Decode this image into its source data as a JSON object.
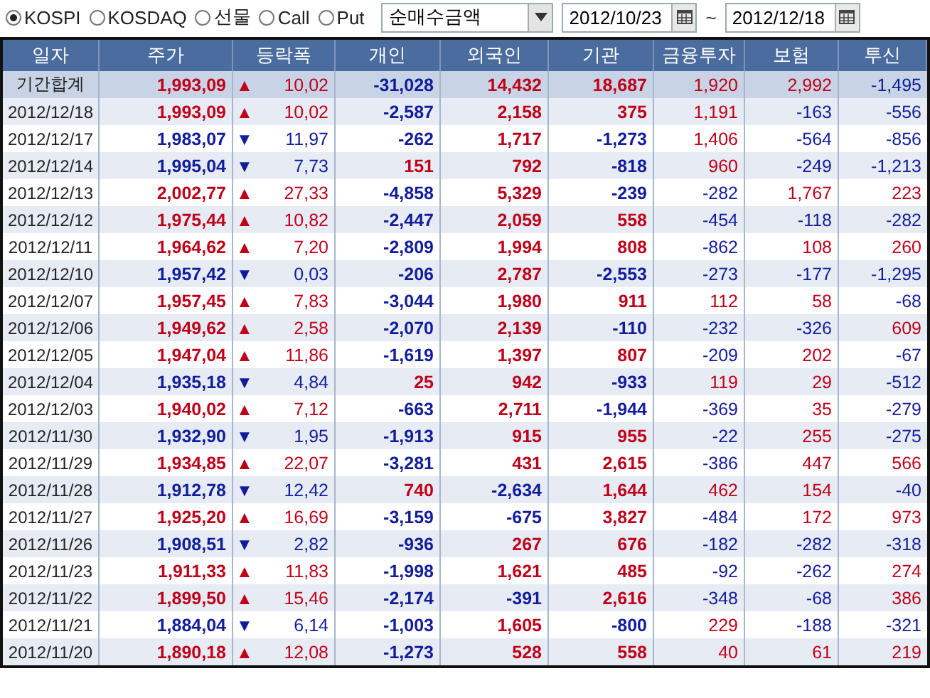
{
  "toolbar": {
    "markets": [
      {
        "label": "KOSPI",
        "selected": true
      },
      {
        "label": "KOSDAQ",
        "selected": false
      },
      {
        "label": "선물",
        "selected": false
      },
      {
        "label": "Call",
        "selected": false
      },
      {
        "label": "Put",
        "selected": false
      }
    ],
    "metric": "순매수금액",
    "date_from": "2012/10/23",
    "range_separator": "~",
    "date_to": "2012/12/18"
  },
  "table": {
    "columns": [
      "일자",
      "주가",
      "등락폭",
      "개인",
      "외국인",
      "기관",
      "금융투자",
      "보험",
      "투신"
    ],
    "rows": [
      {
        "kind": "summary",
        "date": "기간합계",
        "price": "1,993,09",
        "arrow": "▲",
        "color": "#c00018",
        "change": "10,02",
        "values": [
          "-31,028",
          "14,432",
          "18,687",
          "1,920",
          "2,992",
          "-1,495"
        ]
      },
      {
        "kind": "day",
        "date": "2012/12/18",
        "price": "1,993,09",
        "arrow": "▲",
        "color": "#c00018",
        "change": "10,02",
        "values": [
          "-2,587",
          "2,158",
          "375",
          "1,191",
          "-163",
          "-556"
        ]
      },
      {
        "kind": "day",
        "date": "2012/12/17",
        "price": "1,983,07",
        "arrow": "▼",
        "color": "#101c9c",
        "change": "11,97",
        "values": [
          "-262",
          "1,717",
          "-1,273",
          "1,406",
          "-564",
          "-856"
        ]
      },
      {
        "kind": "day",
        "date": "2012/12/14",
        "price": "1,995,04",
        "arrow": "▼",
        "color": "#101c9c",
        "change": "7,73",
        "values": [
          "151",
          "792",
          "-818",
          "960",
          "-249",
          "-1,213"
        ]
      },
      {
        "kind": "day",
        "date": "2012/12/13",
        "price": "2,002,77",
        "arrow": "▲",
        "color": "#c00018",
        "change": "27,33",
        "values": [
          "-4,858",
          "5,329",
          "-239",
          "-282",
          "1,767",
          "223"
        ]
      },
      {
        "kind": "day",
        "date": "2012/12/12",
        "price": "1,975,44",
        "arrow": "▲",
        "color": "#c00018",
        "change": "10,82",
        "values": [
          "-2,447",
          "2,059",
          "558",
          "-454",
          "-118",
          "-282"
        ]
      },
      {
        "kind": "day",
        "date": "2012/12/11",
        "price": "1,964,62",
        "arrow": "▲",
        "color": "#c00018",
        "change": "7,20",
        "values": [
          "-2,809",
          "1,994",
          "808",
          "-862",
          "108",
          "260"
        ]
      },
      {
        "kind": "day",
        "date": "2012/12/10",
        "price": "1,957,42",
        "arrow": "▼",
        "color": "#101c9c",
        "change": "0,03",
        "values": [
          "-206",
          "2,787",
          "-2,553",
          "-273",
          "-177",
          "-1,295"
        ]
      },
      {
        "kind": "day",
        "date": "2012/12/07",
        "price": "1,957,45",
        "arrow": "▲",
        "color": "#c00018",
        "change": "7,83",
        "values": [
          "-3,044",
          "1,980",
          "911",
          "112",
          "58",
          "-68"
        ]
      },
      {
        "kind": "day",
        "date": "2012/12/06",
        "price": "1,949,62",
        "arrow": "▲",
        "color": "#c00018",
        "change": "2,58",
        "values": [
          "-2,070",
          "2,139",
          "-110",
          "-232",
          "-326",
          "609"
        ]
      },
      {
        "kind": "day",
        "date": "2012/12/05",
        "price": "1,947,04",
        "arrow": "▲",
        "color": "#c00018",
        "change": "11,86",
        "values": [
          "-1,619",
          "1,397",
          "807",
          "-209",
          "202",
          "-67"
        ]
      },
      {
        "kind": "day",
        "date": "2012/12/04",
        "price": "1,935,18",
        "arrow": "▼",
        "color": "#101c9c",
        "change": "4,84",
        "values": [
          "25",
          "942",
          "-933",
          "119",
          "29",
          "-512"
        ]
      },
      {
        "kind": "day",
        "date": "2012/12/03",
        "price": "1,940,02",
        "arrow": "▲",
        "color": "#c00018",
        "change": "7,12",
        "values": [
          "-663",
          "2,711",
          "-1,944",
          "-369",
          "35",
          "-279"
        ]
      },
      {
        "kind": "day",
        "date": "2012/11/30",
        "price": "1,932,90",
        "arrow": "▼",
        "color": "#101c9c",
        "change": "1,95",
        "values": [
          "-1,913",
          "915",
          "955",
          "-22",
          "255",
          "-275"
        ]
      },
      {
        "kind": "day",
        "date": "2012/11/29",
        "price": "1,934,85",
        "arrow": "▲",
        "color": "#c00018",
        "change": "22,07",
        "values": [
          "-3,281",
          "431",
          "2,615",
          "-386",
          "447",
          "566"
        ]
      },
      {
        "kind": "day",
        "date": "2012/11/28",
        "price": "1,912,78",
        "arrow": "▼",
        "color": "#101c9c",
        "change": "12,42",
        "values": [
          "740",
          "-2,634",
          "1,644",
          "462",
          "154",
          "-40"
        ]
      },
      {
        "kind": "day",
        "date": "2012/11/27",
        "price": "1,925,20",
        "arrow": "▲",
        "color": "#c00018",
        "change": "16,69",
        "values": [
          "-3,159",
          "-675",
          "3,827",
          "-484",
          "172",
          "973"
        ]
      },
      {
        "kind": "day",
        "date": "2012/11/26",
        "price": "1,908,51",
        "arrow": "▼",
        "color": "#101c9c",
        "change": "2,82",
        "values": [
          "-936",
          "267",
          "676",
          "-182",
          "-282",
          "-318"
        ]
      },
      {
        "kind": "day",
        "date": "2012/11/23",
        "price": "1,911,33",
        "arrow": "▲",
        "color": "#c00018",
        "change": "11,83",
        "values": [
          "-1,998",
          "1,621",
          "485",
          "-92",
          "-262",
          "274"
        ]
      },
      {
        "kind": "day",
        "date": "2012/11/22",
        "price": "1,899,50",
        "arrow": "▲",
        "color": "#c00018",
        "change": "15,46",
        "values": [
          "-2,174",
          "-391",
          "2,616",
          "-348",
          "-68",
          "386"
        ]
      },
      {
        "kind": "day",
        "date": "2012/11/21",
        "price": "1,884,04",
        "arrow": "▼",
        "color": "#101c9c",
        "change": "6,14",
        "values": [
          "-1,003",
          "1,605",
          "-800",
          "229",
          "-188",
          "-321"
        ]
      },
      {
        "kind": "day",
        "date": "2012/11/20",
        "price": "1,890,18",
        "arrow": "▲",
        "color": "#c00018",
        "change": "12,08",
        "values": [
          "-1,273",
          "528",
          "558",
          "40",
          "61",
          "219"
        ]
      }
    ]
  }
}
